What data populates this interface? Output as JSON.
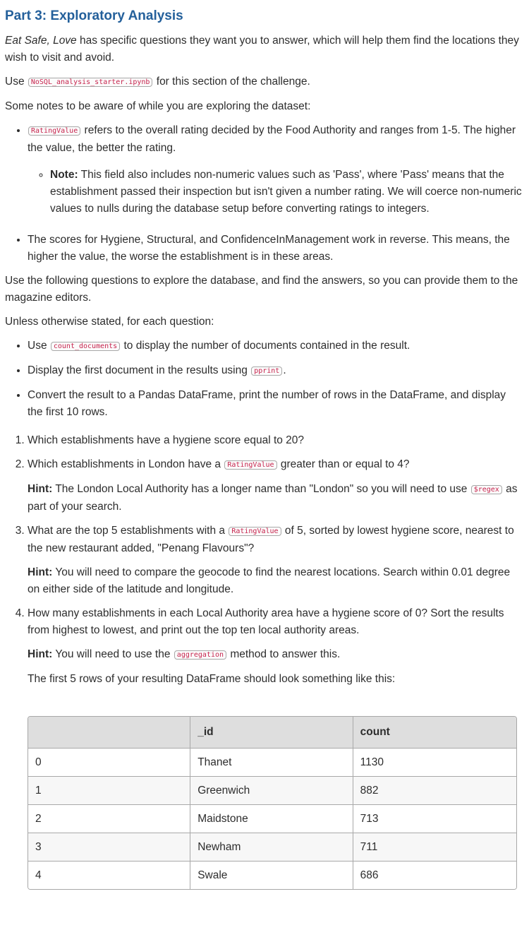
{
  "heading": "Part 3: Exploratory Analysis",
  "intro": {
    "brand": "Eat Safe, Love",
    "text": " has specific questions they want you to answer, which will help them find the locations they wish to visit and avoid."
  },
  "use_line": {
    "before": "Use ",
    "code": "NoSQL_analysis_starter.ipynb",
    "after": " for this section of the challenge."
  },
  "notes_intro": "Some notes to be aware of while you are exploring the dataset:",
  "notes": {
    "rating": {
      "code": "RatingValue",
      "text": " refers to the overall rating decided by the Food Authority and ranges from 1-5. The higher the value, the better the rating.",
      "sub_label": "Note:",
      "sub_text": " This field also includes non-numeric values such as 'Pass', where 'Pass' means that the establishment passed their inspection but isn't given a number rating. We will coerce non-numeric values to nulls during the database setup before converting ratings to integers."
    },
    "scores": "The scores for Hygiene, Structural, and ConfidenceInManagement work in reverse. This means, the higher the value, the worse the establishment is in these areas."
  },
  "questions_intro": "Use the following questions to explore the database, and find the answers, so you can provide them to the magazine editors.",
  "unless": "Unless otherwise stated, for each question:",
  "steps": {
    "count": {
      "before": "Use ",
      "code": "count_documents",
      "after": " to display the number of documents contained in the result."
    },
    "pprint": {
      "before": "Display the first document in the results using ",
      "code": "pprint",
      "after": "."
    },
    "dataframe": "Convert the result to a Pandas DataFrame, print the number of rows in the DataFrame, and display the first 10 rows."
  },
  "questions": {
    "q1": "Which establishments have a hygiene score equal to 20?",
    "q2": {
      "before": "Which establishments in London have a ",
      "code": "RatingValue",
      "after": " greater than or equal to 4?",
      "hint_label": "Hint:",
      "hint_before": " The London Local Authority has a longer name than \"London\" so you will need to use ",
      "hint_code": "$regex",
      "hint_after": " as part of your search."
    },
    "q3": {
      "before": "What are the top 5 establishments with a ",
      "code": "RatingValue",
      "after": " of 5, sorted by lowest hygiene score, nearest to the new restaurant added, \"Penang Flavours\"?",
      "hint_label": "Hint:",
      "hint_text": " You will need to compare the geocode to find the nearest locations. Search within 0.01 degree on either side of the latitude and longitude."
    },
    "q4": {
      "text": "How many establishments in each Local Authority area have a hygiene score of 0? Sort the results from highest to lowest, and print out the top ten local authority areas.",
      "hint_label": "Hint:",
      "hint_before": " You will need to use the ",
      "hint_code": "aggregation",
      "hint_after": " method to answer this.",
      "table_intro": "The first 5 rows of your resulting DataFrame should look something like this:"
    }
  },
  "table": {
    "headers": {
      "index": "",
      "id": "_id",
      "count": "count"
    },
    "rows": [
      {
        "index": "0",
        "id": "Thanet",
        "count": "1130"
      },
      {
        "index": "1",
        "id": "Greenwich",
        "count": "882"
      },
      {
        "index": "2",
        "id": "Maidstone",
        "count": "713"
      },
      {
        "index": "3",
        "id": "Newham",
        "count": "711"
      },
      {
        "index": "4",
        "id": "Swale",
        "count": "686"
      }
    ]
  }
}
